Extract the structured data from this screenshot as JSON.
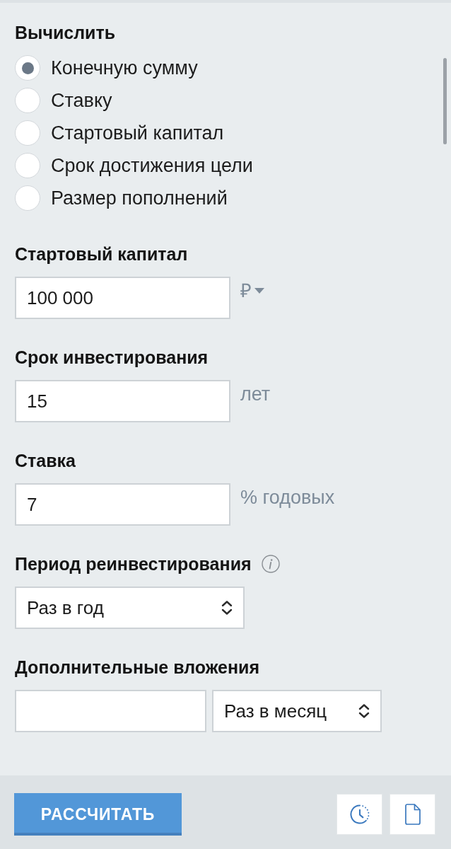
{
  "calculate": {
    "title": "Вычислить",
    "options": [
      {
        "label": "Конечную сумму",
        "selected": true
      },
      {
        "label": "Ставку",
        "selected": false
      },
      {
        "label": "Стартовый капитал",
        "selected": false
      },
      {
        "label": "Срок достижения цели",
        "selected": false
      },
      {
        "label": "Размер пополнений",
        "selected": false
      }
    ]
  },
  "fields": [
    {
      "kind": "input",
      "label": "Стартовый капитал",
      "value": "100 000",
      "unit": {
        "kind": "dropdown",
        "text": "₽"
      }
    },
    {
      "kind": "input",
      "label": "Срок инвестирования",
      "value": "15",
      "unit": {
        "kind": "plain",
        "text": "лет"
      }
    },
    {
      "kind": "input",
      "label": "Ставка",
      "value": "7",
      "unit": {
        "kind": "plain",
        "text": "% годовых"
      }
    },
    {
      "kind": "select",
      "label": "Период реинвестирования",
      "info": true,
      "value": "Раз в год"
    },
    {
      "kind": "input_select",
      "label": "Дополнительные вложения",
      "select_value": "Раз в месяц"
    }
  ],
  "footer": {
    "submit_button": "РАССЧИТАТЬ"
  }
}
